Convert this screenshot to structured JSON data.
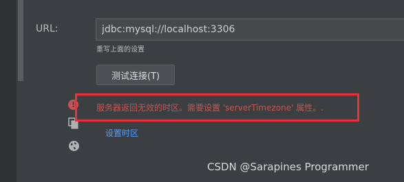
{
  "form": {
    "url_label": "URL:",
    "url_value": "jdbc:mysql://localhost:3306",
    "hint": "重写上面的设置",
    "test_button": "测试连接(T)"
  },
  "error": {
    "icon": "error-icon",
    "message": "服务器返回无效的时区。需要设置 'serverTimezone' 属性。.",
    "highlight_color": "#e8323c"
  },
  "actions": {
    "set_timezone_link": "设置时区",
    "copy_icon": "copy-icon",
    "globe_icon": "globe-icon"
  },
  "watermark": "CSDN @Sarapines Programmer"
}
